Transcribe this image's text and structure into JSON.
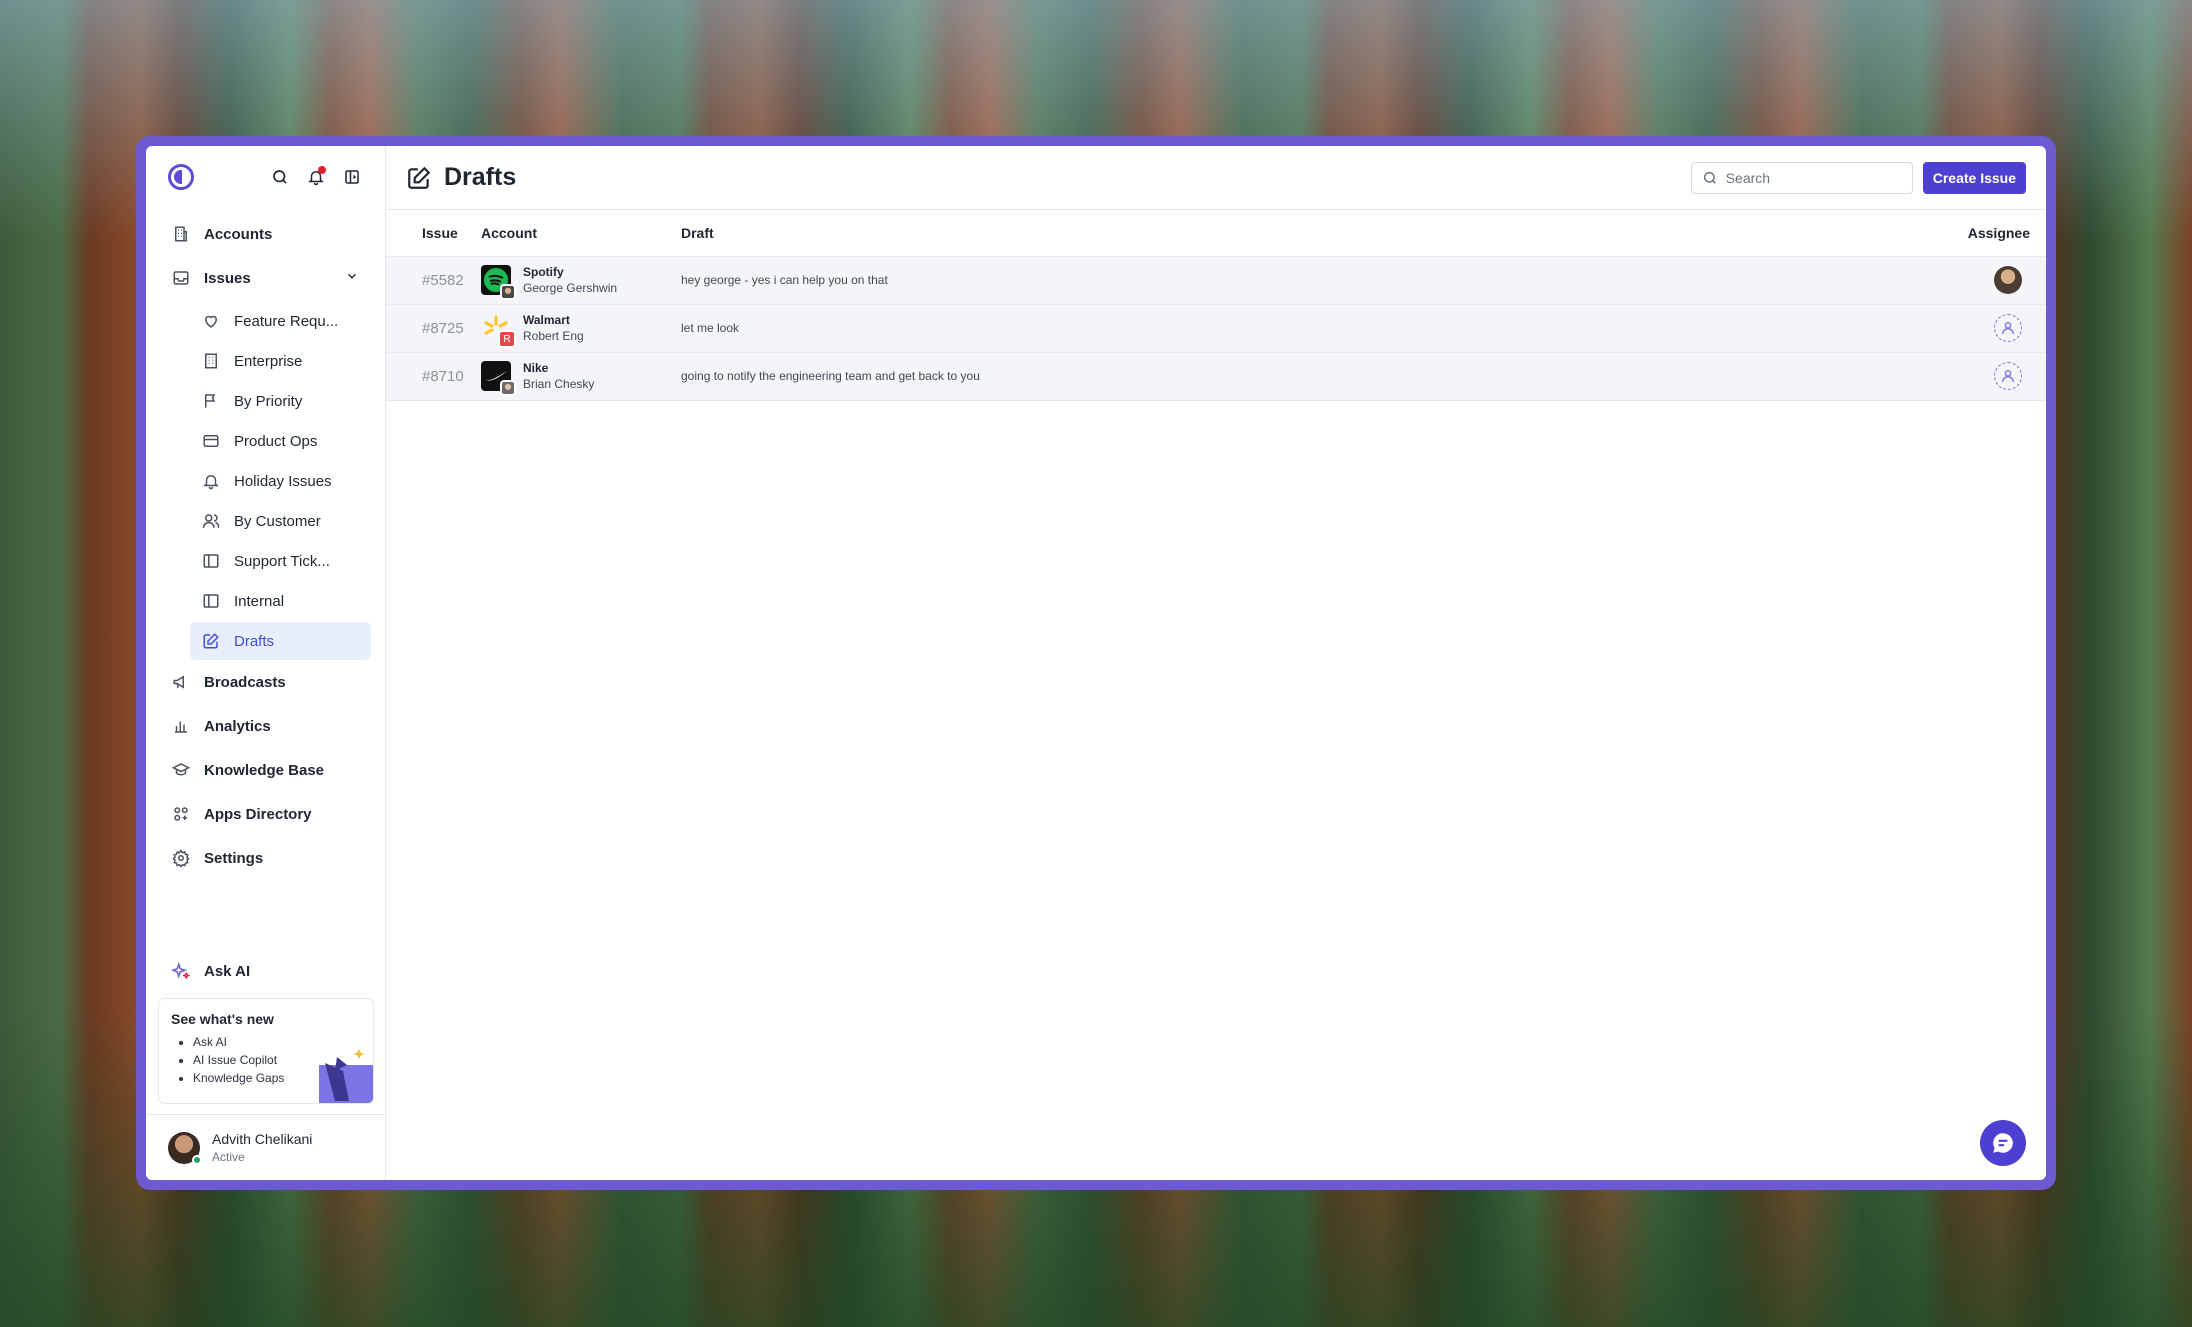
{
  "sidebar": {
    "nav_top": [
      {
        "label": "Accounts",
        "icon": "building-icon"
      },
      {
        "label": "Issues",
        "icon": "inbox-icon"
      }
    ],
    "issues_sub": [
      {
        "label": "Feature Requ...",
        "icon": "heart-icon"
      },
      {
        "label": "Enterprise",
        "icon": "building-icon"
      },
      {
        "label": "By Priority",
        "icon": "flag-icon"
      },
      {
        "label": "Product Ops",
        "icon": "card-icon"
      },
      {
        "label": "Holiday Issues",
        "icon": "bell-icon"
      },
      {
        "label": "By Customer",
        "icon": "users-icon"
      },
      {
        "label": "Support Tick...",
        "icon": "columns-icon"
      },
      {
        "label": "Internal",
        "icon": "columns-icon"
      },
      {
        "label": "Drafts",
        "icon": "draft-icon"
      }
    ],
    "nav_bottom": [
      {
        "label": "Broadcasts",
        "icon": "megaphone-icon"
      },
      {
        "label": "Analytics",
        "icon": "bar-chart-icon"
      },
      {
        "label": "Knowledge Base",
        "icon": "graduation-cap-icon"
      },
      {
        "label": "Apps Directory",
        "icon": "apps-icon"
      },
      {
        "label": "Settings",
        "icon": "gear-icon"
      }
    ],
    "ask_ai": "Ask AI",
    "whats_new": {
      "title": "See what's new",
      "items": [
        "Ask AI",
        "AI Issue Copilot",
        "Knowledge Gaps"
      ]
    },
    "user": {
      "name": "Advith Chelikani",
      "status": "Active"
    }
  },
  "header": {
    "title": "Drafts",
    "search_placeholder": "Search",
    "create_label": "Create Issue"
  },
  "table": {
    "columns": {
      "issue": "Issue",
      "account": "Account",
      "draft": "Draft",
      "assignee": "Assignee"
    },
    "rows": [
      {
        "issue": "#5582",
        "account": "Spotify",
        "contact": "George Gershwin",
        "draft": "hey george - yes i can help you on that",
        "assignee": "avatar"
      },
      {
        "issue": "#8725",
        "account": "Walmart",
        "contact": "Robert Eng",
        "draft": "let me look",
        "assignee": "unassigned"
      },
      {
        "issue": "#8710",
        "account": "Nike",
        "contact": "Brian Chesky",
        "draft": "going to notify the engineering team and get back to you",
        "assignee": "unassigned"
      }
    ]
  },
  "colors": {
    "accent": "#4d3fd1",
    "frame": "#6d5ad0",
    "active_bg": "#e9eefb"
  },
  "walmart_initial": "R"
}
